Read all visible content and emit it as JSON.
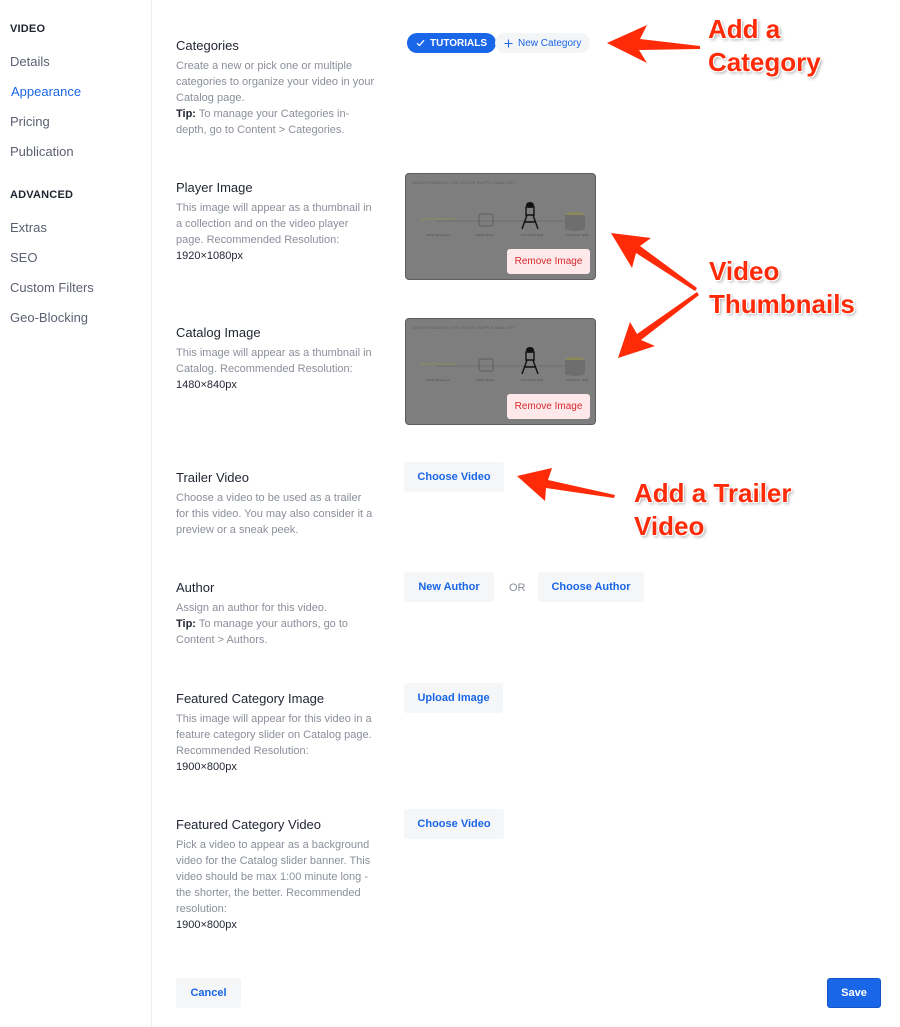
{
  "sidebar": {
    "sections": [
      {
        "label": "VIDEO",
        "items": [
          "Details",
          "Appearance",
          "Pricing",
          "Publication"
        ]
      },
      {
        "label": "ADVANCED",
        "items": [
          "Extras",
          "SEO",
          "Custom Filters",
          "Geo-Blocking"
        ]
      }
    ],
    "active_item": "Appearance"
  },
  "categories": {
    "title": "Categories",
    "desc": "Create a new or pick one or multiple categories to organize your video in your Catalog page.",
    "tip_label": "Tip:",
    "tip": " To manage your Categories in-depth, go to Content > Categories.",
    "selected_chip": "TUTORIALS",
    "new_chip": "New Category"
  },
  "player_image": {
    "title": "Player Image",
    "desc": "This image will appear as a thumbnail in a collection and on the video player page. Recommended Resolution:",
    "resolution": "1920×1080px",
    "thumb_title": "UNDERSTANDING THE WATER SUPPLY ANALOGY",
    "remove_label": "Remove Image"
  },
  "catalog_image": {
    "title": "Catalog Image",
    "desc": "This image will appear as a thumbnail in Catalog. Recommended Resolution:",
    "resolution": "1480×840px",
    "thumb_title": "UNDERSTANDING THE WATER SUPPLY ANALOGY",
    "remove_label": "Remove Image"
  },
  "trailer_video": {
    "title": "Trailer Video",
    "desc": "Choose a video to be used as a trailer for this video. You may also consider it a preview or a sneak peek.",
    "button": "Choose Video"
  },
  "author": {
    "title": "Author",
    "desc": "Assign an author for this video.",
    "tip_label": "Tip:",
    "tip": " To manage your authors, go to Content > Authors.",
    "new_button": "New Author",
    "or_label": "OR",
    "choose_button": "Choose Author"
  },
  "featured_image": {
    "title": "Featured Category Image",
    "desc": "This image will appear for this video in a feature category slider on Catalog page. Recommended Resolution:",
    "resolution": "1900×800px",
    "button": "Upload Image"
  },
  "featured_video": {
    "title": "Featured Category Video",
    "desc": "Pick a video to appear as a background video for the Catalog slider banner. This video should be max 1:00 minute long - the shorter, the better. Recommended resolution:",
    "resolution": "1900×800px",
    "button": "Choose Video"
  },
  "footer": {
    "cancel": "Cancel",
    "save": "Save"
  },
  "annotations": {
    "category": [
      "Add a",
      "Category"
    ],
    "thumbnails": [
      "Video",
      "Thumbnails"
    ],
    "trailer": [
      "Add a Trailer",
      "Video"
    ]
  },
  "colors": {
    "accent": "#1a66e8",
    "annotation": "#ff2a08",
    "danger": "#d8282f"
  }
}
